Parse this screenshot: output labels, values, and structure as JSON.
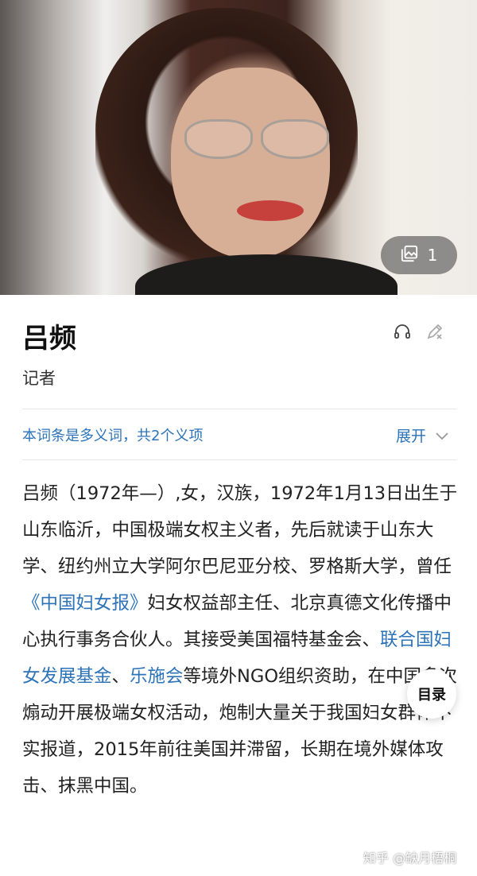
{
  "hero": {
    "gallery_count": "1",
    "gallery_icon": "image-gallery-icon"
  },
  "entry": {
    "title": "吕频",
    "subtitle": "记者"
  },
  "actions": {
    "listen_icon": "headphones-icon",
    "edit_icon": "edit-pencil-icon"
  },
  "polysemy": {
    "text": "本词条是多义词，共2个义项",
    "expand_label": "展开"
  },
  "content": {
    "p1": "吕频（1972年—）,女，汉族，1972年1月13日出生于山东临沂，中国极端女权主义者，先后就读于山东大学、纽约州立大学阿尔巴尼亚分校、罗格斯大学，曾任",
    "link1": "《中国妇女报》",
    "p2": "妇女权益部主任、北京真德文化传播中心执行事务合伙人。其接受美国福特基金会、",
    "link2": "联合国妇女发展基金",
    "sep": "、",
    "link3": "乐施会",
    "p3": "等境外NGO组织资助，在中国多次煽动开展极端女权活动，炮制大量关于我国妇女群体不实报道，2015年前往美国并滞留，长期在境外媒体攻击、抹黑中国。"
  },
  "toc": {
    "label": "目录"
  },
  "watermark": "知乎 @缺月梧桐",
  "colors": {
    "link": "#2c73b8",
    "text": "#222222",
    "divider": "#e6e6e6"
  }
}
